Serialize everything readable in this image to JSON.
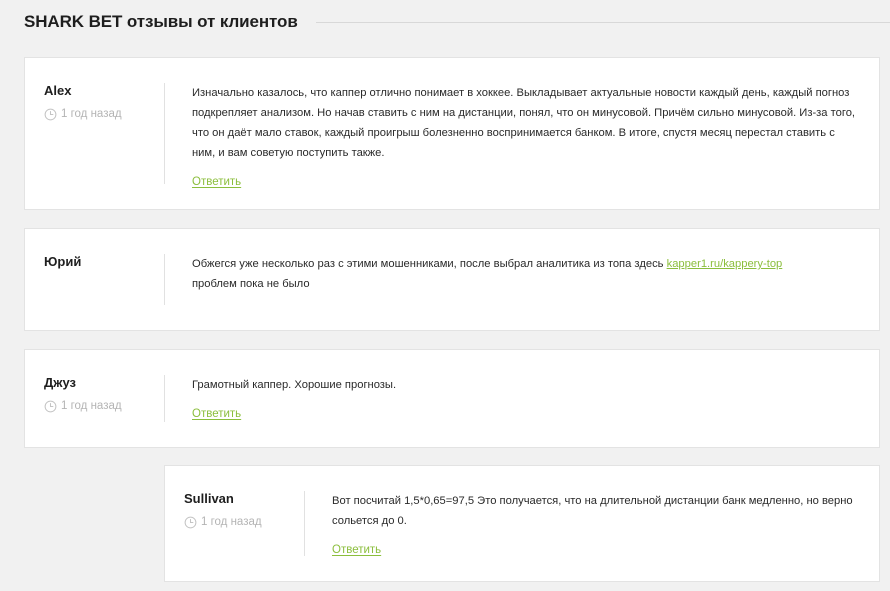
{
  "section": {
    "title": "SHARK BET отзывы от клиентов"
  },
  "reviews": [
    {
      "author": "Alex",
      "time": "1 год назад",
      "text": "Изначально казалось, что каппер отлично понимает в хоккее. Выкладывает актуальные новости каждый день, каждый погноз подкрепляет анализом. Но начав ставить с ним на дистанции, понял, что он минусовой. Причём сильно минусовой. Из-за того, что он даёт мало ставок, каждый проигрыш болезненно воспринимается банком. В итоге, спустя месяц перестал ставить с ним, и вам советую поступить также.",
      "reply_label": "Ответить"
    },
    {
      "author": "Юрий",
      "text_before": "Обжегся уже несколько раз с этими мошенниками, после выбрал аналитика из топа здесь ",
      "link_text": "kapper1.ru/kappery-top",
      "text_after": "проблем пока не было"
    },
    {
      "author": "Джуз",
      "time": "1 год назад",
      "text": "Грамотный каппер. Хорошие прогнозы.",
      "reply_label": "Ответить"
    },
    {
      "author": "Sullivan",
      "time": "1 год назад",
      "text": "Вот посчитай 1,5*0,65=97,5 Это получается, что на длительной дистанции банк медленно, но верно сольется до 0.",
      "reply_label": "Ответить"
    }
  ],
  "colors": {
    "accent": "#8bbe3c",
    "background": "#f1f1f1",
    "card": "#ffffff"
  },
  "icons": {
    "time": "clock-icon"
  }
}
